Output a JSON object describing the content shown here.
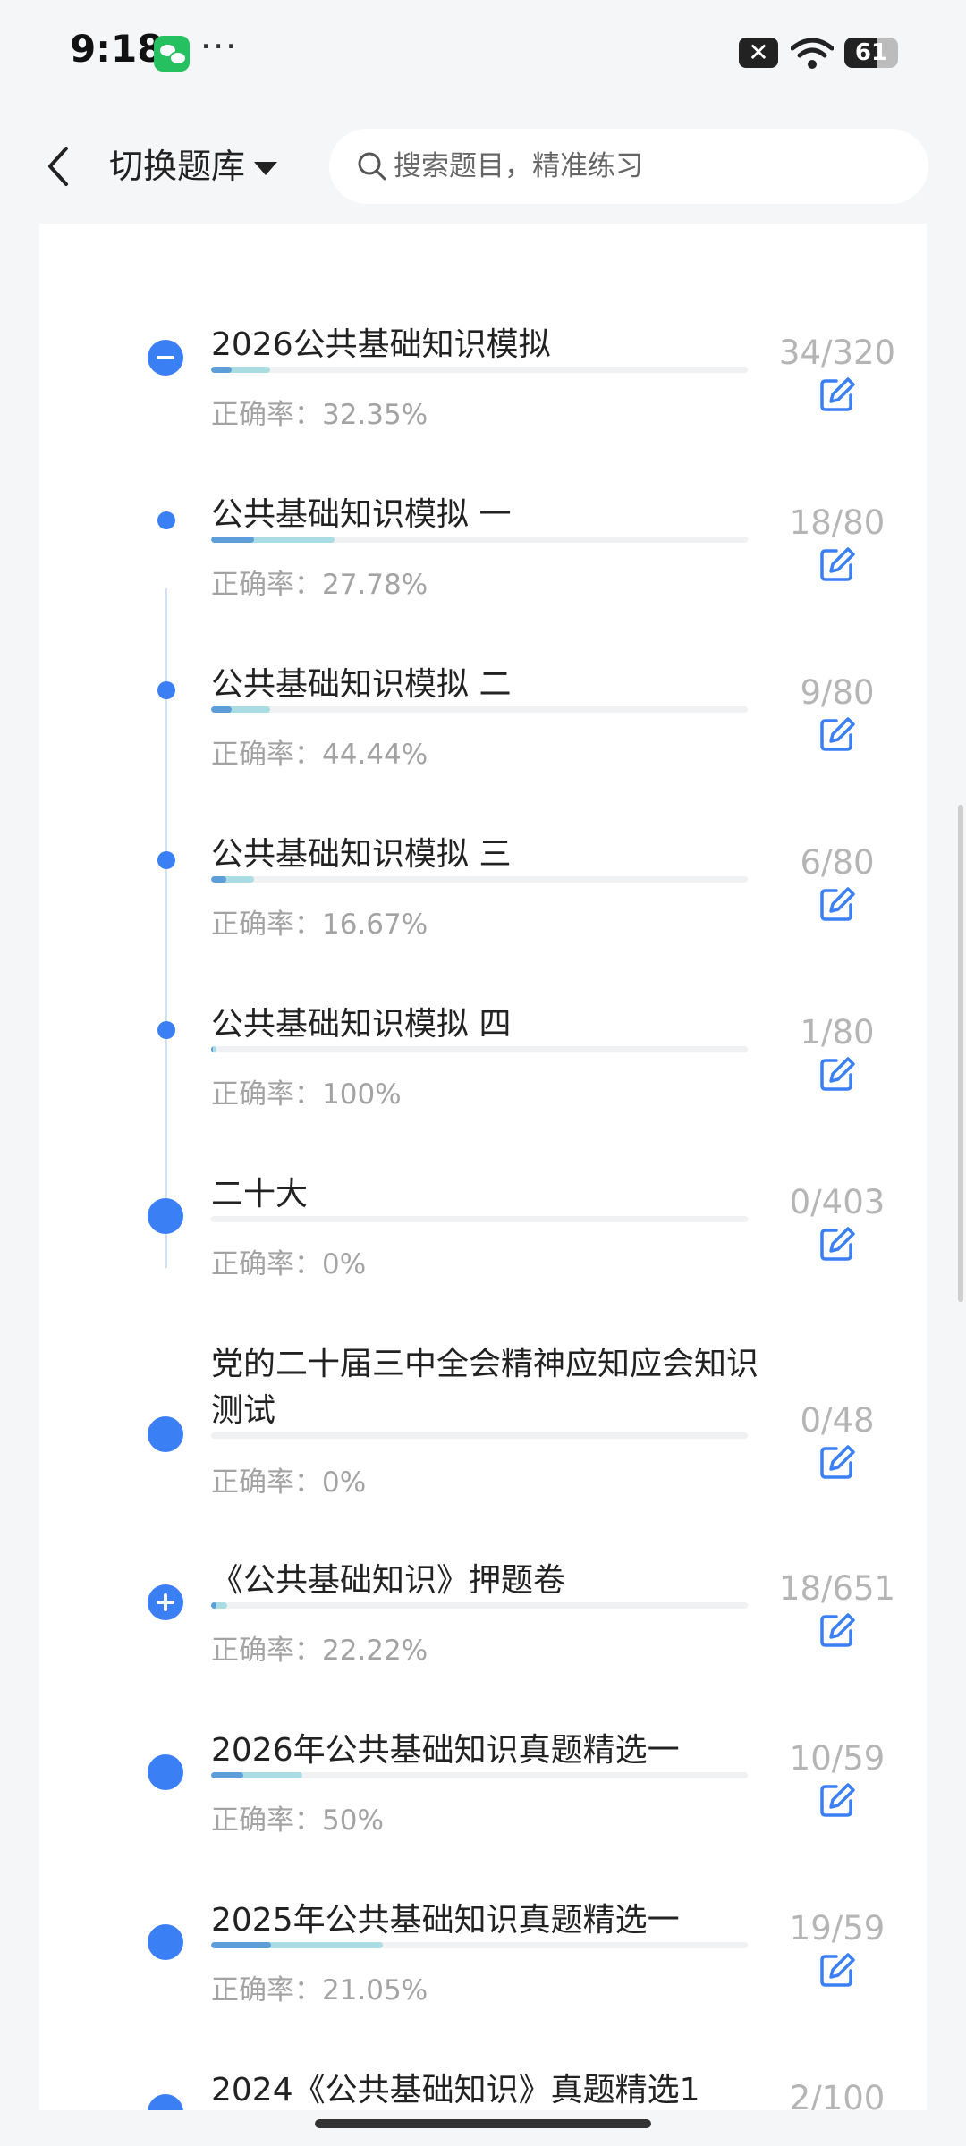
{
  "status_bar": {
    "time": "9:18",
    "more": "···",
    "battery": "61"
  },
  "header": {
    "switch_label": "切换题库",
    "search_placeholder": "搜索题目，精准练习"
  },
  "accuracy_prefix": "正确率：",
  "items": [
    {
      "title": "",
      "accuracy": "0%",
      "count": "",
      "node": "big",
      "progress": 0.0
    },
    {
      "title": "2026公共基础知识模拟",
      "accuracy": "32.35%",
      "count": "34/320",
      "node": "minus",
      "progress": 0.11
    },
    {
      "title": "公共基础知识模拟 一",
      "accuracy": "27.78%",
      "count": "18/80",
      "node": "small",
      "progress": 0.23
    },
    {
      "title": "公共基础知识模拟 二",
      "accuracy": "44.44%",
      "count": "9/80",
      "node": "small",
      "progress": 0.11
    },
    {
      "title": "公共基础知识模拟 三",
      "accuracy": "16.67%",
      "count": "6/80",
      "node": "small",
      "progress": 0.08
    },
    {
      "title": "公共基础知识模拟 四",
      "accuracy": "100%",
      "count": "1/80",
      "node": "small",
      "progress": 0.01
    },
    {
      "title": "二十大",
      "accuracy": "0%",
      "count": "0/403",
      "node": "big",
      "progress": 0.0
    },
    {
      "title": "党的二十届三中全会精神应知应会知识测试",
      "accuracy": "0%",
      "count": "0/48",
      "node": "big",
      "progress": 0.0
    },
    {
      "title": "《公共基础知识》押题卷",
      "accuracy": "22.22%",
      "count": "18/651",
      "node": "plus",
      "progress": 0.03
    },
    {
      "title": "2026年公共基础知识真题精选一",
      "accuracy": "50%",
      "count": "10/59",
      "node": "big",
      "progress": 0.17
    },
    {
      "title": "2025年公共基础知识真题精选一",
      "accuracy": "21.05%",
      "count": "19/59",
      "node": "big",
      "progress": 0.32
    },
    {
      "title": "2024《公共基础知识》真题精选1",
      "accuracy": "",
      "count": "2/100",
      "node": "big",
      "progress": 0.02
    }
  ],
  "colors": {
    "accent": "#3b7ff5",
    "bar_fill": "#aadce4",
    "bar_current": "#5e9ed8",
    "muted": "#a3a3a3"
  }
}
